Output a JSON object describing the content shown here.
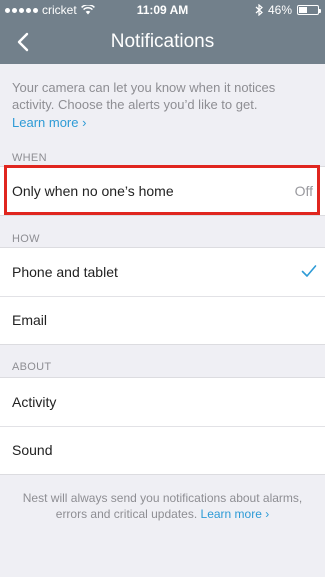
{
  "status_bar": {
    "carrier": "cricket",
    "time": "11:09 AM",
    "battery": "46%",
    "battery_level": 0.46
  },
  "header": {
    "title": "Notifications",
    "back_icon": "chevron-left-icon"
  },
  "intro": {
    "text": "Your camera can let you know when it notices activity. Choose the alerts you’d like to get.",
    "link": "Learn more ›"
  },
  "sections": {
    "when": {
      "label": "WHEN",
      "rows": [
        {
          "label": "Only when no one’s home",
          "value": "Off"
        }
      ]
    },
    "how": {
      "label": "HOW",
      "rows": [
        {
          "label": "Phone and tablet",
          "checked": true
        },
        {
          "label": "Email"
        }
      ]
    },
    "about": {
      "label": "ABOUT",
      "rows": [
        {
          "label": "Activity"
        },
        {
          "label": "Sound"
        }
      ]
    }
  },
  "footer": {
    "text": "Nest will always send you notifications about alarms, errors and critical updates.",
    "link": "Learn more ›"
  },
  "colors": {
    "header": "#72808b",
    "link": "#2e9bd6",
    "highlight": "#e0261f",
    "background": "#efeff4"
  }
}
